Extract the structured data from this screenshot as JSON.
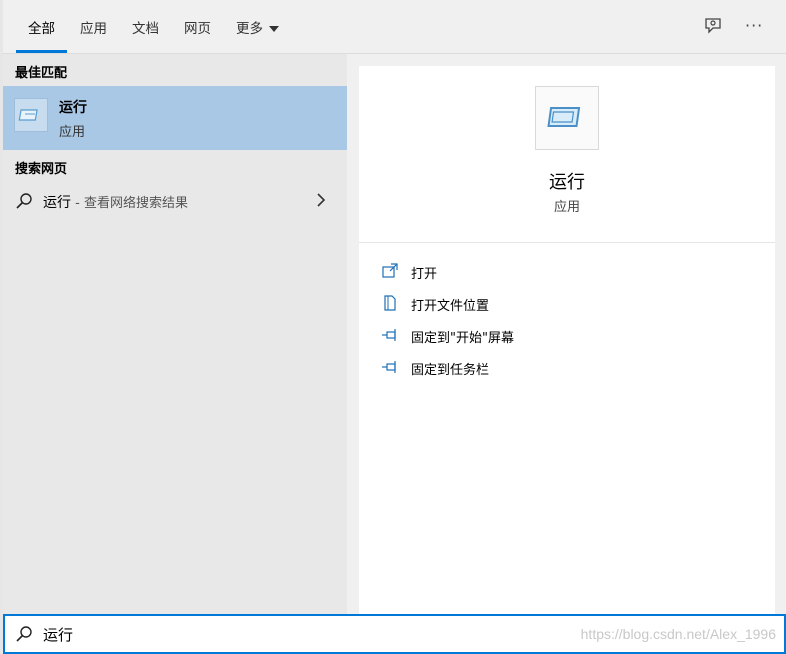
{
  "tabs": [
    {
      "label": "全部"
    },
    {
      "label": "应用"
    },
    {
      "label": "文档"
    },
    {
      "label": "网页"
    },
    {
      "label": "更多"
    }
  ],
  "toolbar": {
    "feedback_icon": "feedback-icon",
    "more_icon": "ellipsis-icon",
    "more_label": "···"
  },
  "left": {
    "best_match_heading": "最佳匹配",
    "best_match": {
      "name": "运行",
      "type": "应用",
      "icon": "run-app-icon"
    },
    "web_heading": "搜索网页",
    "web_result": {
      "query": "运行",
      "suffix": " - 查看网络搜索结果"
    }
  },
  "right": {
    "name": "运行",
    "type": "应用",
    "actions": [
      {
        "label": "打开",
        "icon": "open-icon"
      },
      {
        "label": "打开文件位置",
        "icon": "file-location-icon"
      },
      {
        "label": "固定到\"开始\"屏幕",
        "icon": "pin-icon"
      },
      {
        "label": "固定到任务栏",
        "icon": "pin-icon"
      }
    ]
  },
  "search": {
    "value": "运行"
  },
  "watermark": "https://blog.csdn.net/Alex_1996",
  "colors": {
    "accent": "#0078d7",
    "selected": "#a8c8e6"
  }
}
